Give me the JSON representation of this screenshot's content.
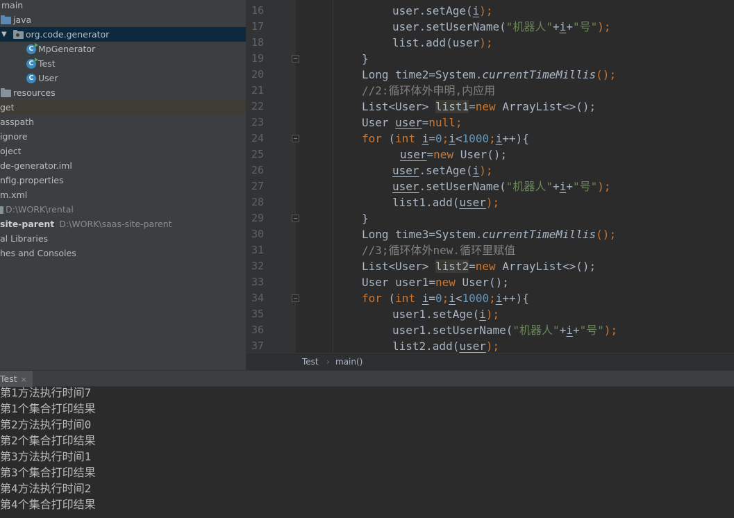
{
  "project_tree": {
    "rows": [
      {
        "label": "main"
      },
      {
        "label": "java"
      },
      {
        "label": "org.code.generator",
        "expanded": true,
        "selected": true
      },
      {
        "label": "MpGenerator"
      },
      {
        "label": "Test"
      },
      {
        "label": "User"
      },
      {
        "label": "resources"
      },
      {
        "label": "get",
        "current": true
      },
      {
        "label": "asspath"
      },
      {
        "label": "ignore"
      },
      {
        "label": "oject"
      },
      {
        "label": "de-generator.iml"
      },
      {
        "label": "nfig.properties"
      },
      {
        "label": "m.xml"
      },
      {
        "label": "",
        "path": "D:\\WORK\\rental"
      },
      {
        "label": "site-parent",
        "path": "D:\\WORK\\saas-site-parent"
      },
      {
        "label": "al Libraries"
      },
      {
        "label": "hes and Consoles"
      }
    ]
  },
  "editor": {
    "line_numbers": [
      "16",
      "17",
      "18",
      "19",
      "20",
      "21",
      "22",
      "23",
      "24",
      "25",
      "26",
      "27",
      "28",
      "29",
      "30",
      "31",
      "32",
      "33",
      "34",
      "35",
      "36",
      "37"
    ],
    "tokens": {
      "user": "user",
      "setAge": ".setAge(",
      "i": "i",
      "close_semi": ");",
      "setUserName": ".setUserName(",
      "str_robot": "\"机器人\"",
      "plus": "+",
      "str_hao": "\"号\"",
      "list_add": "list.add(",
      "brace_close": "}",
      "long": "Long ",
      "time2": "time2=System.",
      "time3": "time3=System.",
      "ctm": "currentTimeMillis",
      "parens_semi": "();",
      "comment2": "//2:循环体外申明,内应用",
      "comment3": "//3;循环体外new.循环里赋值",
      "list_user": "List<User> ",
      "list1": "list1",
      "list2": "list2",
      "assign": "=",
      "new": "new ",
      "arraylist": "ArrayList<>();",
      "user_type": "User ",
      "null": "null",
      "semi": ";",
      "for": "for ",
      "paren_open": "(",
      "int": "int ",
      "zero": "0",
      "lt": "<",
      "thousand": "1000",
      "inc_open": "++){",
      "user_ctor": "User();",
      "list1_add": "list1.add(",
      "list2_add": "list2.add(",
      "user1": "user1",
      "user1_decl": "user1=",
      "list_decl_cont": ""
    }
  },
  "breadcrumb": {
    "items": [
      "Test",
      "main()"
    ],
    "separator": "›"
  },
  "run_panel": {
    "tab_label": "Test",
    "close_glyph": "×",
    "output": [
      "第1方法执行时间7",
      "第1个集合打印结果",
      "第2方法执行时间0",
      "第2个集合打印结果",
      "第3方法执行时间1",
      "第3个集合打印结果",
      "第4方法执行时间2",
      "第4个集合打印结果"
    ]
  },
  "colors": {
    "keyword": "#cc7832",
    "number": "#6897bb",
    "string": "#6a8759",
    "comment": "#808080",
    "text": "#a9b7c6",
    "selection": "#0d293e"
  },
  "icons": [
    "folder-icon",
    "package-icon",
    "class-icon",
    "run-class-icon",
    "fold-icon",
    "expand-arrow-icon",
    "close-icon"
  ]
}
